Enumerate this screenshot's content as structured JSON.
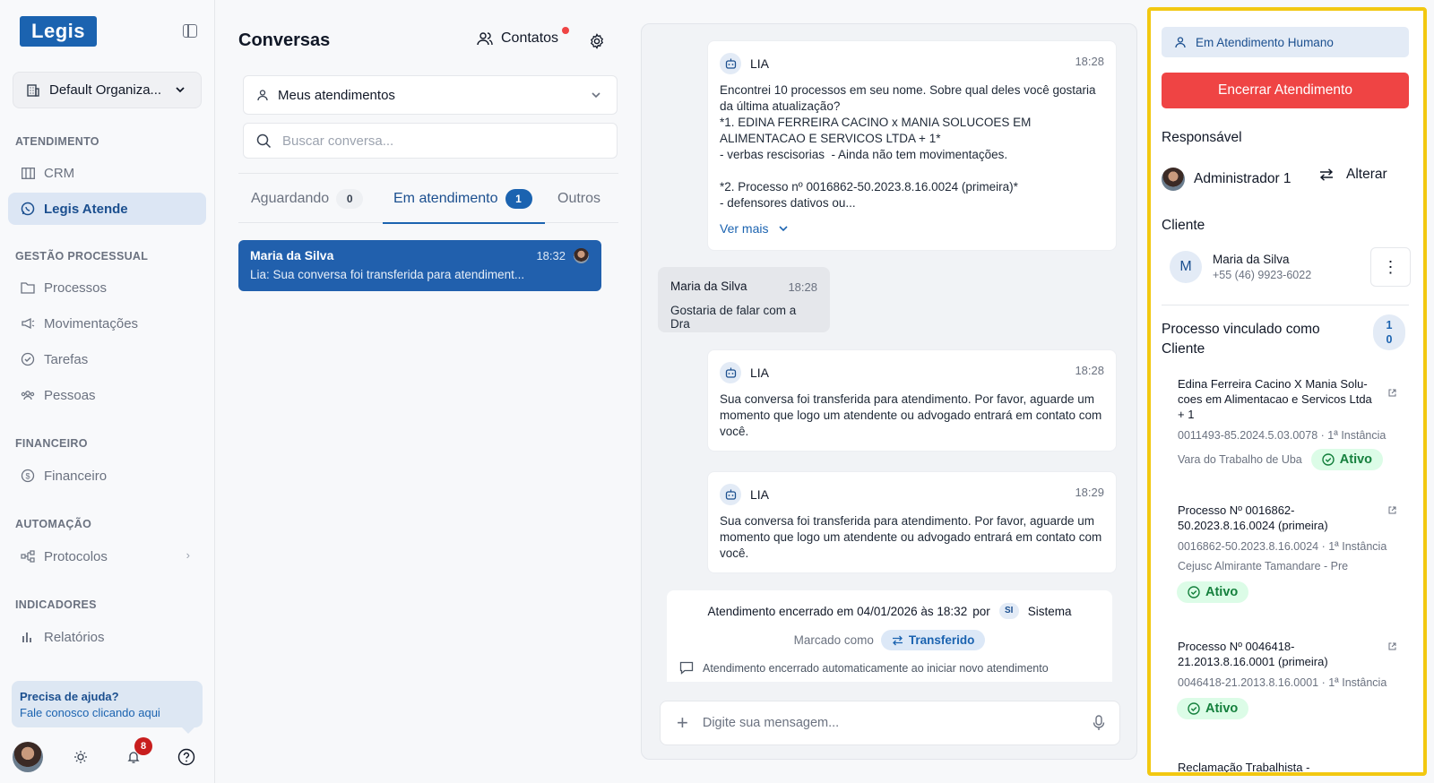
{
  "app": {
    "logo": "Legis"
  },
  "sidebar": {
    "org": "Default Organiza...",
    "sections": {
      "atendimento": "ATENDIMENTO",
      "gestao": "GESTÃO PROCESSUAL",
      "financeiro": "FINANCEIRO",
      "automacao": "AUTOMAÇÃO",
      "indicadores": "INDICADORES"
    },
    "items": {
      "crm": "CRM",
      "legis_atende": "Legis Atende",
      "processos": "Processos",
      "movimentacoes": "Movimentações",
      "tarefas": "Tarefas",
      "pessoas": "Pessoas",
      "financeiro": "Financeiro",
      "protocolos": "Protocolos",
      "relatorios": "Relatórios"
    },
    "help": {
      "title": "Precisa de ajuda?",
      "link": "Fale conosco clicando aqui"
    },
    "notifications_count": "8"
  },
  "conversas": {
    "title": "Conversas",
    "contatos": "Contatos",
    "filter": "Meus atendimentos",
    "search_placeholder": "Buscar conversa...",
    "tabs": [
      {
        "label": "Aguardando",
        "count": "0"
      },
      {
        "label": "Em atendimento",
        "count": "1"
      },
      {
        "label": "Outros"
      }
    ],
    "items": [
      {
        "name": "Maria da Silva",
        "time": "18:32",
        "preview": "Lia: Sua conversa foi transferida para atendiment..."
      }
    ]
  },
  "chat": {
    "messages": [
      {
        "author": "LIA",
        "time": "18:28",
        "body": "Encontrei 10 processos em seu nome. Sobre qual deles você gostaria da última atualização?\n*1. EDINA FERREIRA CACINO x MANIA SOLUCOES EM ALIMENTACAO E SERVICOS LTDA + 1*\n- verbas rescisorias  - Ainda não tem movimentações.\n\n*2. Processo nº 0016862-50.2023.8.16.0024 (primeira)*\n- defensores dativos ou...",
        "more": "Ver mais"
      },
      {
        "author": "Maria da Silva",
        "time": "18:28",
        "body": "Gostaria de falar com a Dra"
      },
      {
        "author": "LIA",
        "time": "18:28",
        "body": "Sua conversa foi transferida para atendimento. Por favor, aguarde um momento que logo um atendente ou advogado entrará em contato com você."
      },
      {
        "author": "LIA",
        "time": "18:29",
        "body": "Sua conversa foi transferida para atendimento. Por favor, aguarde um momento que logo um atendente ou advogado entrará em contato com você."
      }
    ],
    "closed": {
      "text": "Atendimento encerrado em 04/01/2026 às 18:32",
      "por": "por",
      "badge": "SI",
      "by": "Sistema",
      "marked_as": "Marcado como",
      "tag": "Transferido",
      "note": "Atendimento encerrado automaticamente ao iniciar novo atendimento"
    },
    "composer_placeholder": "Digite sua mensagem..."
  },
  "details": {
    "status": "Em Atendimento Humano",
    "end_button": "Encerrar Atendimento",
    "responsavel_label": "Responsável",
    "responsavel": "Administrador 1",
    "alterar": "Alterar",
    "cliente_label": "Cliente",
    "cliente": {
      "initial": "M",
      "name": "Maria da Silva",
      "phone": "+55 (46) 9923-6022"
    },
    "processos_label": "Processo vinculado como Cliente",
    "processos_count": "10",
    "processos": [
      {
        "title": "Edina Ferreira Cacino X Mania Solu-coes em Alimentacao e Servicos Ltda + 1",
        "number": "0011493-85.2024.5.03.0078 · 1ª Instância",
        "court": "Vara do Trabalho de Uba",
        "status": "Ativo"
      },
      {
        "title": "Processo Nº 0016862-50.2023.8.16.0024 (primeira)",
        "number": "0016862-50.2023.8.16.0024 · 1ª Instância",
        "court": "Cejusc Almirante Tamandare - Pre",
        "status": "Ativo"
      },
      {
        "title": "Processo Nº 0046418-21.2013.8.16.0001 (primeira)",
        "number": "0046418-21.2013.8.16.0001 · 1ª Instância",
        "court": "",
        "status": "Ativo"
      },
      {
        "title": "Reclamação Trabalhista -"
      }
    ]
  },
  "colors": {
    "primary": "#1b63b0",
    "danger": "#ef4444",
    "highlight": "#f2c811",
    "success": "#15803d"
  }
}
